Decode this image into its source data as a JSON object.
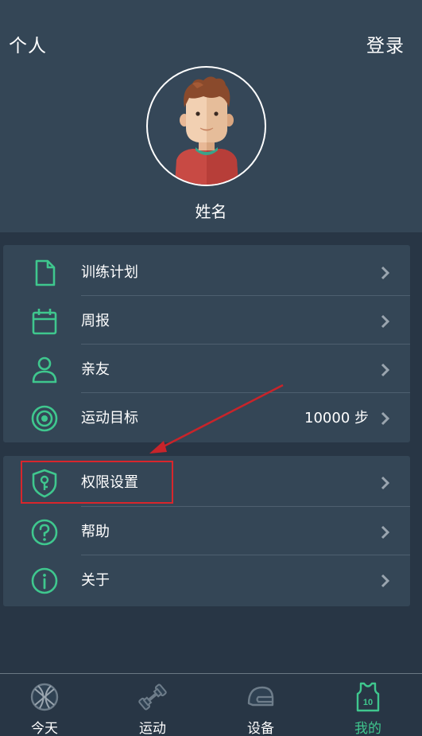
{
  "header": {
    "title": "个人",
    "login_label": "登录",
    "username": "姓名"
  },
  "menu_group_1": [
    {
      "label": "训练计划",
      "icon": "document-icon"
    },
    {
      "label": "周报",
      "icon": "calendar-icon"
    },
    {
      "label": "亲友",
      "icon": "person-icon"
    },
    {
      "label": "运动目标",
      "icon": "target-icon",
      "value": "10000 步"
    }
  ],
  "menu_group_2": [
    {
      "label": "权限设置",
      "icon": "shield-key-icon"
    },
    {
      "label": "帮助",
      "icon": "help-icon"
    },
    {
      "label": "关于",
      "icon": "info-icon"
    }
  ],
  "tabbar": [
    {
      "label": "今天",
      "icon": "basketball-icon",
      "active": false
    },
    {
      "label": "运动",
      "icon": "dumbbell-icon",
      "active": false
    },
    {
      "label": "设备",
      "icon": "helmet-icon",
      "active": false
    },
    {
      "label": "我的",
      "icon": "jersey-icon",
      "active": true,
      "badge": "10"
    }
  ],
  "colors": {
    "accent": "#3fc78e",
    "background": "#283645",
    "card": "#344656",
    "annotation": "#d8262c"
  }
}
